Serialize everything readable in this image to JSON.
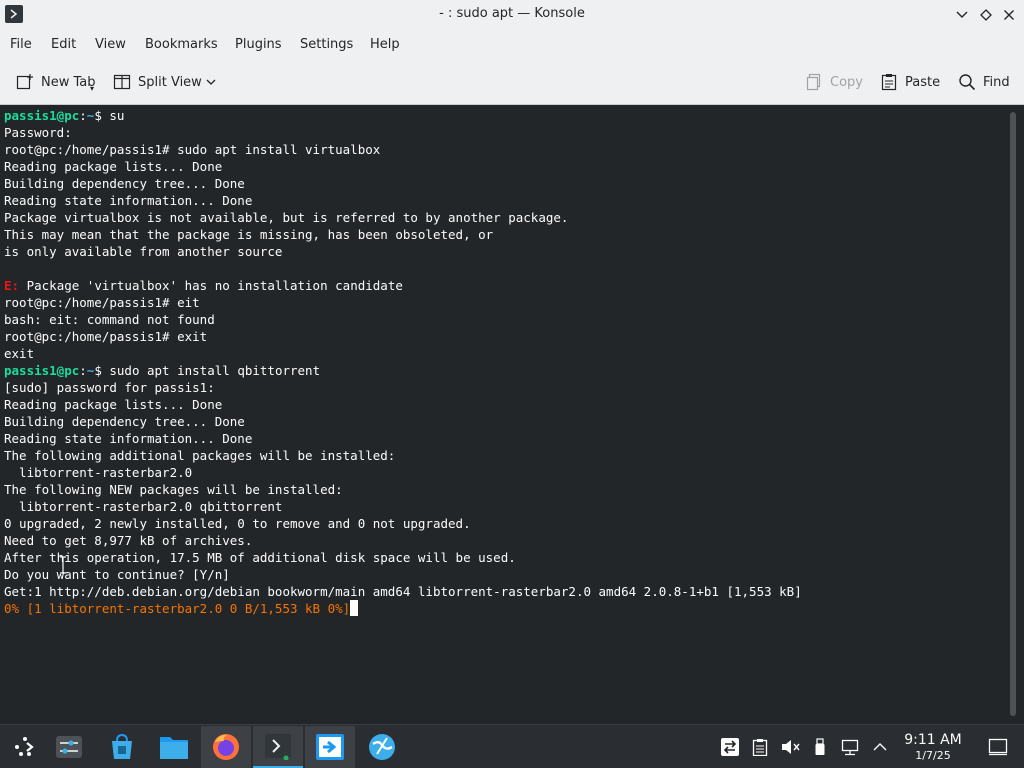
{
  "window": {
    "title": "- : sudo apt — Konsole"
  },
  "menu": [
    "File",
    "Edit",
    "View",
    "Bookmarks",
    "Plugins",
    "Settings",
    "Help"
  ],
  "toolbar": {
    "new_tab": "New Tab",
    "split_view": "Split View",
    "copy": "Copy",
    "paste": "Paste",
    "find": "Find"
  },
  "terminal": {
    "lines": [
      [
        {
          "t": "passis1@pc",
          "c": "prompt"
        },
        {
          "t": ":",
          "c": ""
        },
        {
          "t": "~",
          "c": "path"
        },
        {
          "t": "$ su",
          "c": ""
        }
      ],
      [
        {
          "t": "Password:",
          "c": ""
        }
      ],
      [
        {
          "t": "root@pc:/home/passis1# sudo apt install virtualbox",
          "c": ""
        }
      ],
      [
        {
          "t": "Reading package lists... Done",
          "c": ""
        }
      ],
      [
        {
          "t": "Building dependency tree... Done",
          "c": ""
        }
      ],
      [
        {
          "t": "Reading state information... Done",
          "c": ""
        }
      ],
      [
        {
          "t": "Package virtualbox is not available, but is referred to by another package.",
          "c": ""
        }
      ],
      [
        {
          "t": "This may mean that the package is missing, has been obsoleted, or",
          "c": ""
        }
      ],
      [
        {
          "t": "is only available from another source",
          "c": ""
        }
      ],
      [],
      [
        {
          "t": "E:",
          "c": "err"
        },
        {
          "t": " Package 'virtualbox' has no installation candidate",
          "c": ""
        }
      ],
      [
        {
          "t": "root@pc:/home/passis1# eit",
          "c": ""
        }
      ],
      [
        {
          "t": "bash: eit: command not found",
          "c": ""
        }
      ],
      [
        {
          "t": "root@pc:/home/passis1# exit",
          "c": ""
        }
      ],
      [
        {
          "t": "exit",
          "c": ""
        }
      ],
      [
        {
          "t": "passis1@pc",
          "c": "prompt"
        },
        {
          "t": ":",
          "c": ""
        },
        {
          "t": "~",
          "c": "path"
        },
        {
          "t": "$ sudo apt install qbittorrent",
          "c": ""
        }
      ],
      [
        {
          "t": "[sudo] password for passis1:",
          "c": ""
        }
      ],
      [
        {
          "t": "Reading package lists... Done",
          "c": ""
        }
      ],
      [
        {
          "t": "Building dependency tree... Done",
          "c": ""
        }
      ],
      [
        {
          "t": "Reading state information... Done",
          "c": ""
        }
      ],
      [
        {
          "t": "The following additional packages will be installed:",
          "c": ""
        }
      ],
      [
        {
          "t": "  libtorrent-rasterbar2.0",
          "c": ""
        }
      ],
      [
        {
          "t": "The following NEW packages will be installed:",
          "c": ""
        }
      ],
      [
        {
          "t": "  libtorrent-rasterbar2.0 qbittorrent",
          "c": ""
        }
      ],
      [
        {
          "t": "0 upgraded, 2 newly installed, 0 to remove and 0 not upgraded.",
          "c": ""
        }
      ],
      [
        {
          "t": "Need to get 8,977 kB of archives.",
          "c": ""
        }
      ],
      [
        {
          "t": "After this operation, 17.5 MB of additional disk space will be used.",
          "c": ""
        }
      ],
      [
        {
          "t": "Do you want to continue? [Y/n]",
          "c": ""
        }
      ],
      [
        {
          "t": "Get:1 http://deb.debian.org/debian bookworm/main amd64 libtorrent-rasterbar2.0 amd64 2.0.8-1+b1 [1,553 kB]",
          "c": ""
        }
      ],
      [
        {
          "t": "0% [1 libtorrent-rasterbar2.0 0 B/1,553 kB 0%]",
          "c": "orange"
        }
      ]
    ]
  },
  "taskbar": {
    "apps": [
      "launcher-icon",
      "system-settings-icon",
      "discover-store-icon",
      "file-manager-icon",
      "firefox-icon",
      "konsole-icon",
      "remote-desktop-icon",
      "web-browser-icon"
    ],
    "tray": [
      "task-switch-icon",
      "clipboard-icon",
      "volume-muted-icon",
      "usb-device-icon",
      "network-icon",
      "expand-tray-icon"
    ],
    "time": "9:11 AM",
    "date": "1/7/25"
  },
  "colors": {
    "terminal_bg": "#232629",
    "prompt_user": "#1cdc9a",
    "prompt_path": "#3daee9",
    "error": "#ed1515",
    "progress": "#f67400",
    "chrome_bg": "#eff0f1"
  }
}
